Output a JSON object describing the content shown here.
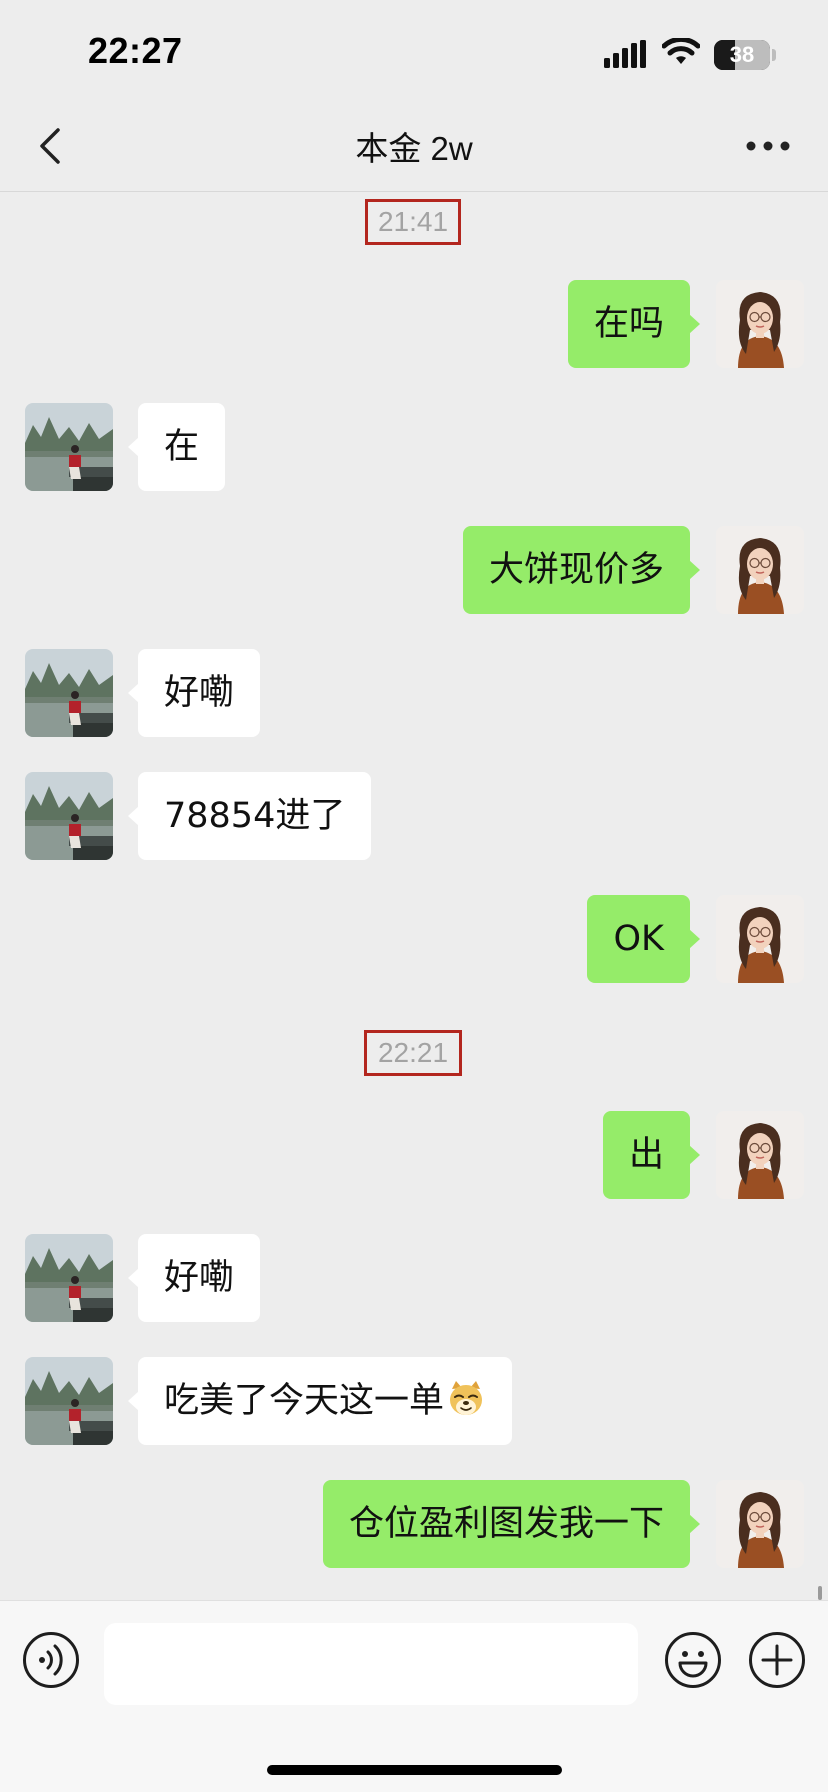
{
  "status_bar": {
    "time": "22:27",
    "battery": "38",
    "battery_level": 0.38,
    "icons": [
      "cellular-signal-icon",
      "wifi-icon",
      "battery-icon"
    ]
  },
  "nav": {
    "title": "本金 2w",
    "back_icon": "chevron-left-icon",
    "more_icon": "more-dots-icon"
  },
  "messages": [
    {
      "type": "time",
      "text": "21:41"
    },
    {
      "type": "msg",
      "side": "right",
      "text": "在吗"
    },
    {
      "type": "msg",
      "side": "left",
      "text": "在"
    },
    {
      "type": "msg",
      "side": "right",
      "text": "大饼现价多"
    },
    {
      "type": "msg",
      "side": "left",
      "text": "好嘞"
    },
    {
      "type": "msg",
      "side": "left",
      "text": "78854进了"
    },
    {
      "type": "msg",
      "side": "right",
      "text": "OK"
    },
    {
      "type": "time",
      "text": "22:21"
    },
    {
      "type": "msg",
      "side": "right",
      "text": "出"
    },
    {
      "type": "msg",
      "side": "left",
      "text": "好嘞"
    },
    {
      "type": "msg",
      "side": "left",
      "text": "吃美了今天这一单",
      "emoji": "doge-emoji"
    },
    {
      "type": "msg",
      "side": "right",
      "text": "仓位盈利图发我一下"
    }
  ],
  "input_bar": {
    "voice_icon": "voice-icon",
    "input_value": "",
    "emoji_icon": "emoji-icon",
    "plus_icon": "plus-icon"
  },
  "colors": {
    "background": "#ededed",
    "outgoing_bubble": "#95ec69",
    "incoming_bubble": "#ffffff",
    "timestamp_text": "#a3a3a3",
    "timestamp_highlight": "#b3261e"
  }
}
